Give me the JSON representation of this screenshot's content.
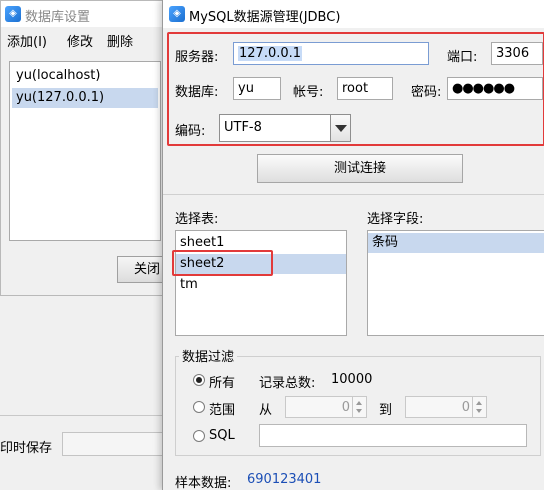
{
  "background_window": {
    "title": "数据库设置",
    "menu": [
      "添加(I)",
      "修改",
      "删除"
    ],
    "connections": [
      "yu(localhost)",
      "yu(127.0.0.1)"
    ],
    "selected_connection": "yu(127.0.0.1)",
    "close_label": "关闭",
    "save_label": "印时保存"
  },
  "dialog": {
    "title": "MySQL数据源管理(JDBC)",
    "server_label": "服务器:",
    "server_value": "127.0.0.1",
    "port_label": "端口:",
    "port_value": "3306",
    "database_label": "数据库:",
    "database_value": "yu",
    "account_label": "帐号:",
    "account_value": "root",
    "password_label": "密码:",
    "password_value": "●●●●●●",
    "encoding_label": "编码:",
    "encoding_value": "UTF-8",
    "test_button": "测试连接",
    "select_table_label": "选择表:",
    "tables": [
      "sheet1",
      "sheet2",
      "tm"
    ],
    "selected_table": "sheet2",
    "select_field_label": "选择字段:",
    "fields": [
      "条码"
    ],
    "filter": {
      "legend": "数据过滤",
      "all_label": "所有",
      "total_label": "记录总数:",
      "total_value": "10000",
      "range_label": "范围",
      "from_label": "从",
      "from_value": "0",
      "to_label": "到",
      "to_value": "0",
      "sql_label": "SQL",
      "selected": "所有"
    },
    "sample_label": "样本数据:",
    "sample_value": "690123401"
  },
  "colors": {
    "highlight_red": "#e23a3a",
    "selection_blue": "#c8d8ee",
    "sample_text": "#1c4fb6"
  }
}
